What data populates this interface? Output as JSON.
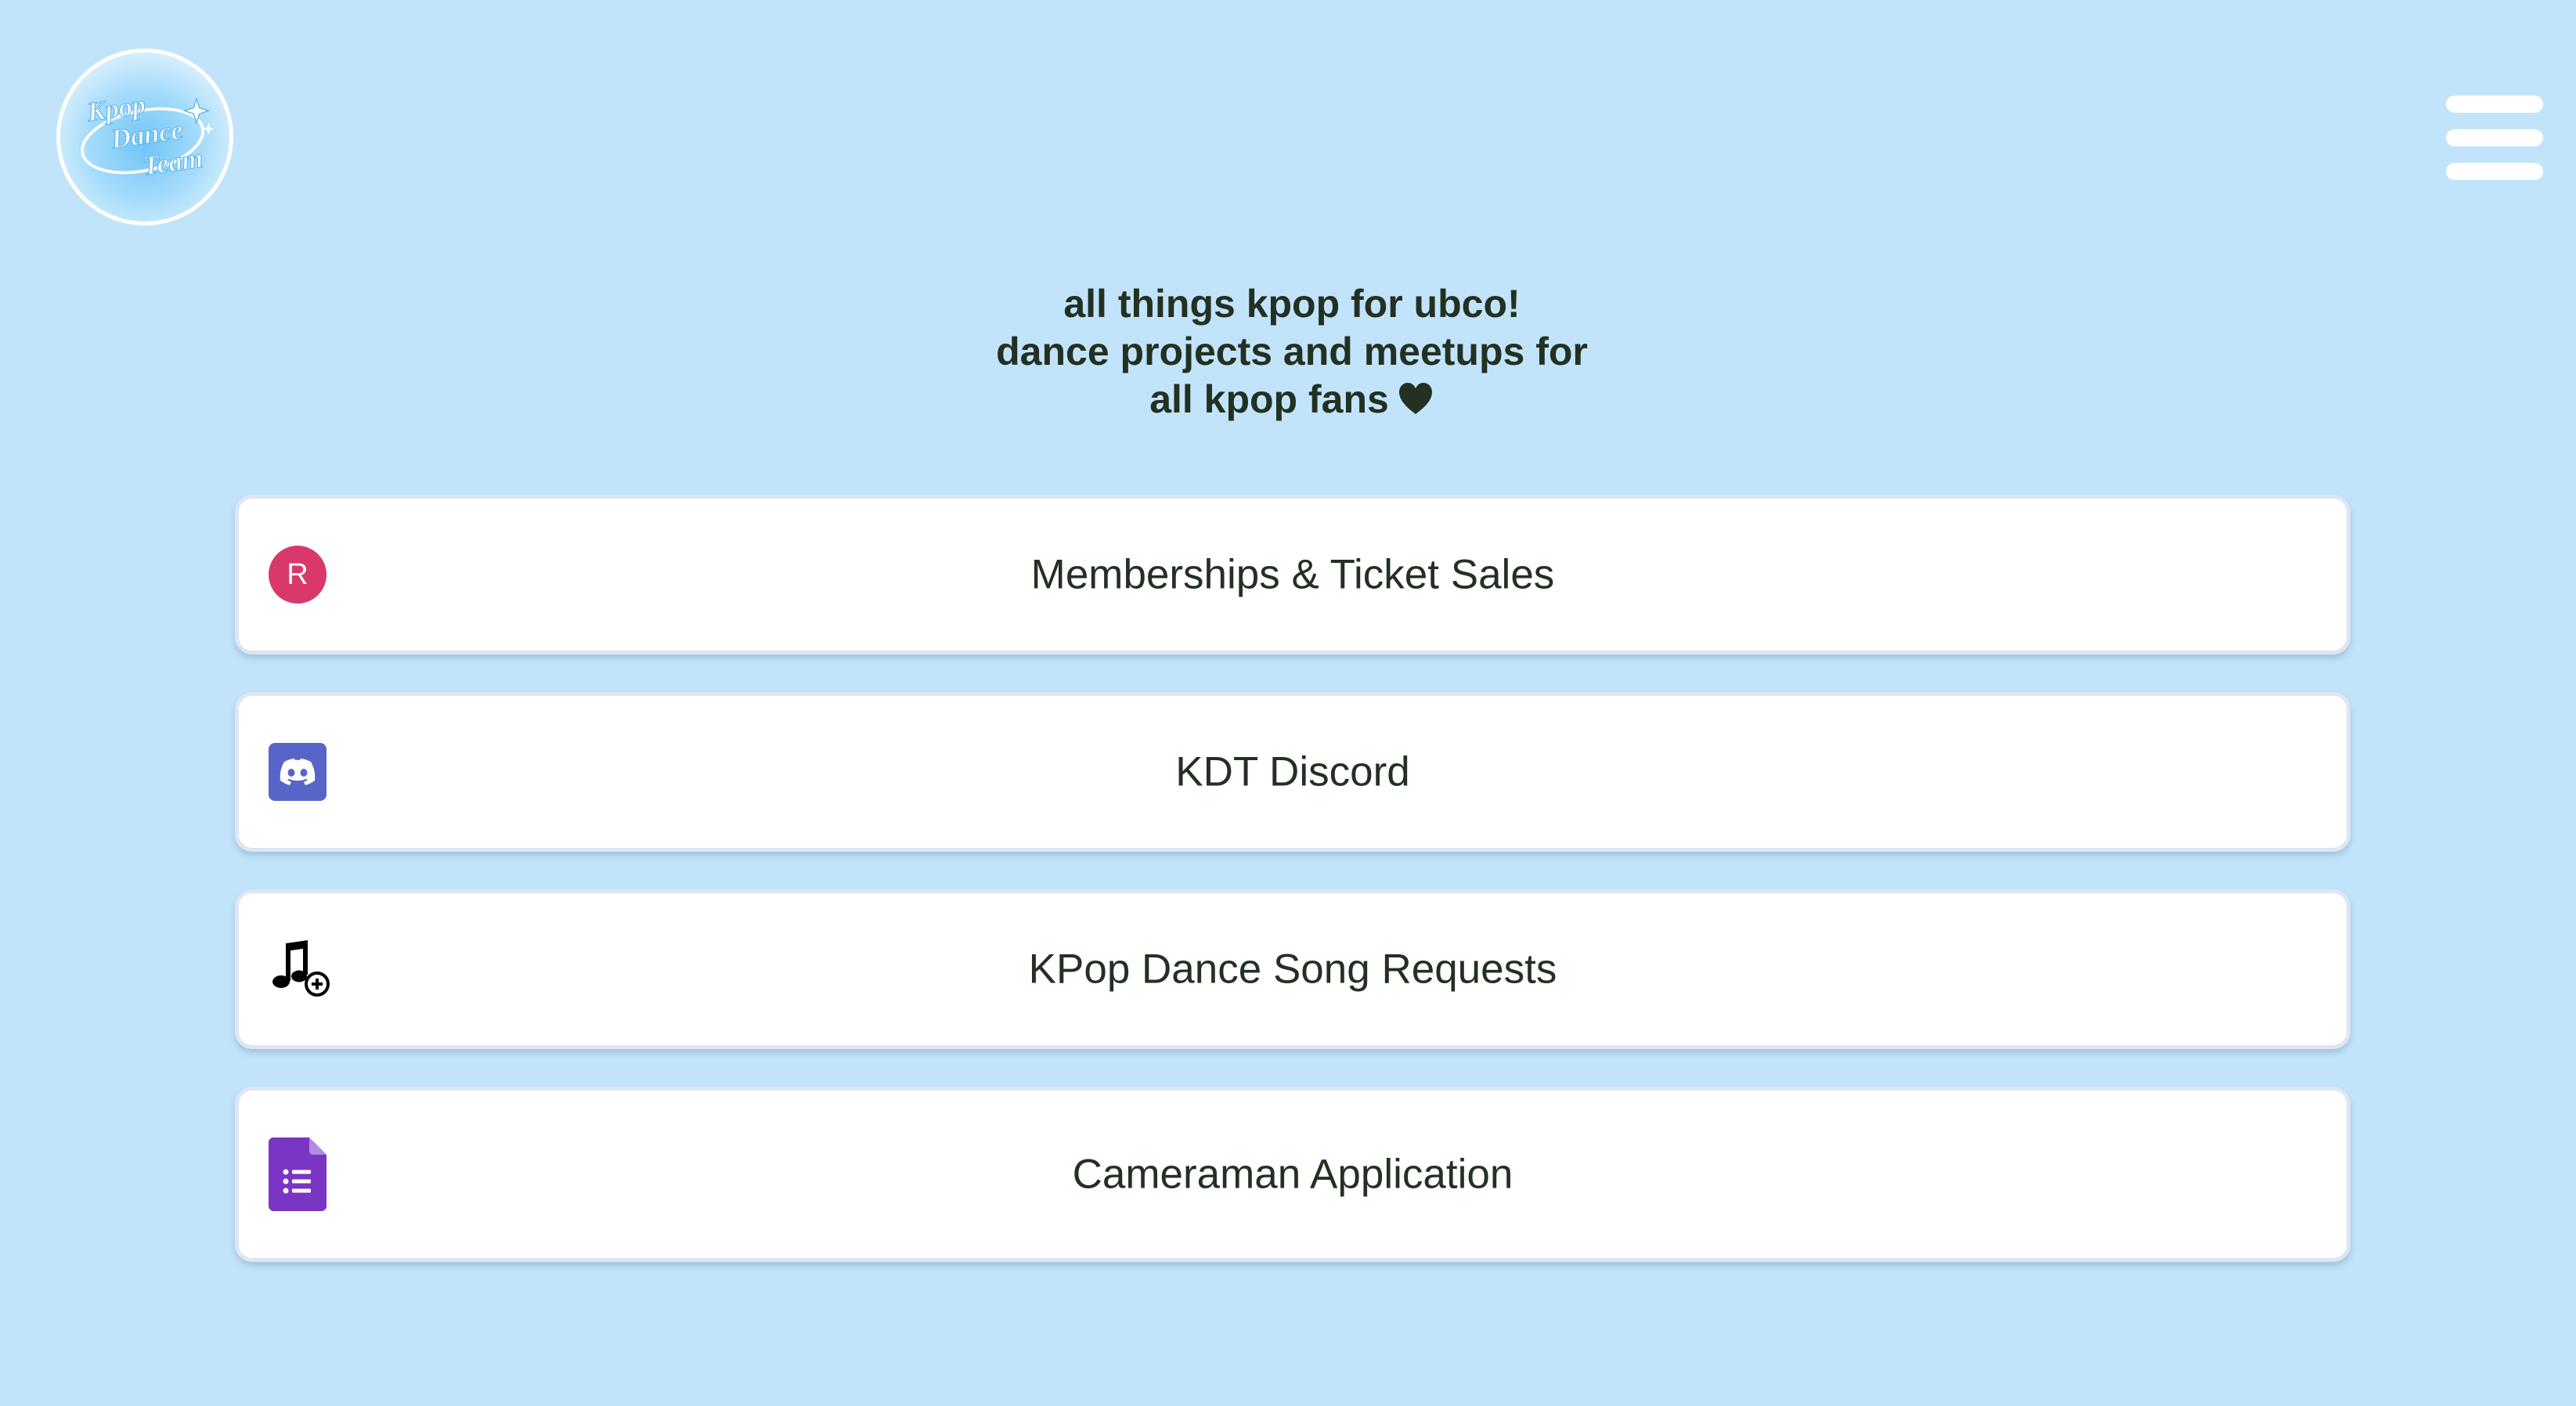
{
  "header": {
    "logo": {
      "icon": "kpop-dance-team-logo",
      "text_lines": [
        "Kpop",
        "Dance",
        "Team"
      ]
    },
    "menu_icon": "hamburger-menu-icon"
  },
  "bio": {
    "lines": [
      "all things kpop for ubco!",
      "dance projects and meetups for",
      "all kpop fans"
    ],
    "heart_icon": "black-heart-icon"
  },
  "links": [
    {
      "label": "Memberships & Ticket Sales",
      "icon": "r-circle-icon",
      "icon_letter": "R",
      "icon_color": "#d9386b"
    },
    {
      "label": "KDT Discord",
      "icon": "discord-icon",
      "icon_color": "#5865c8"
    },
    {
      "label": "KPop Dance Song Requests",
      "icon": "music-note-add-icon"
    },
    {
      "label": "Cameraman Application",
      "icon": "google-forms-icon",
      "icon_color": "#7b35c4"
    }
  ],
  "colors": {
    "background": "#c2e4fa",
    "button_background": "#ffffff",
    "text": "#233022"
  }
}
